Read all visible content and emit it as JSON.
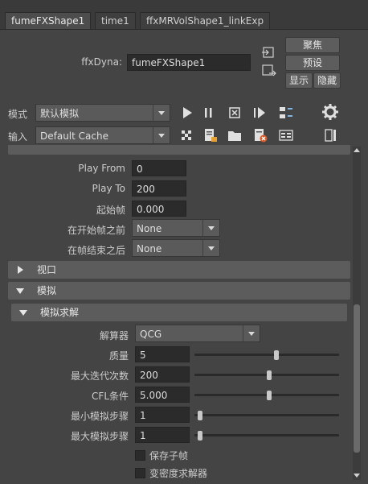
{
  "tabs": [
    "fumeFXShape1",
    "time1",
    "ffxMRVolShape1_linkExp"
  ],
  "node": {
    "label": "ffxDyna:",
    "value": "fumeFXShape1"
  },
  "side_buttons": {
    "focus": "聚焦",
    "presets": "预设",
    "show": "显示",
    "hide": "隐藏"
  },
  "mode_row": {
    "label": "模式",
    "value": "默认模拟"
  },
  "input_row": {
    "label": "输入",
    "value": "Default Cache"
  },
  "playback": {
    "play_from": {
      "label": "Play From",
      "value": "0"
    },
    "play_to": {
      "label": "Play To",
      "value": "200"
    },
    "start_frame": {
      "label": "起始帧",
      "value": "0.000"
    },
    "before_start": {
      "label": "在开始帧之前",
      "value": "None"
    },
    "after_end": {
      "label": "在帧结束之后",
      "value": "None"
    }
  },
  "sections": {
    "viewport": "视口",
    "simulation": "模拟",
    "solver": "模拟求解"
  },
  "solver": {
    "solver": {
      "label": "解算器",
      "value": "QCG"
    },
    "quality": {
      "label": "质量",
      "value": "5",
      "level": 0.55
    },
    "max_iter": {
      "label": "最大迭代次数",
      "value": "200",
      "level": 0.5
    },
    "cfl": {
      "label": "CFL条件",
      "value": "5.000",
      "level": 0.5
    },
    "min_steps": {
      "label": "最小模拟步骤",
      "value": "1",
      "level": 0
    },
    "max_steps": {
      "label": "最大模拟步骤",
      "value": "1",
      "level": 0
    },
    "save_subframes": "保存子帧",
    "variable_density": "变密度求解器"
  }
}
